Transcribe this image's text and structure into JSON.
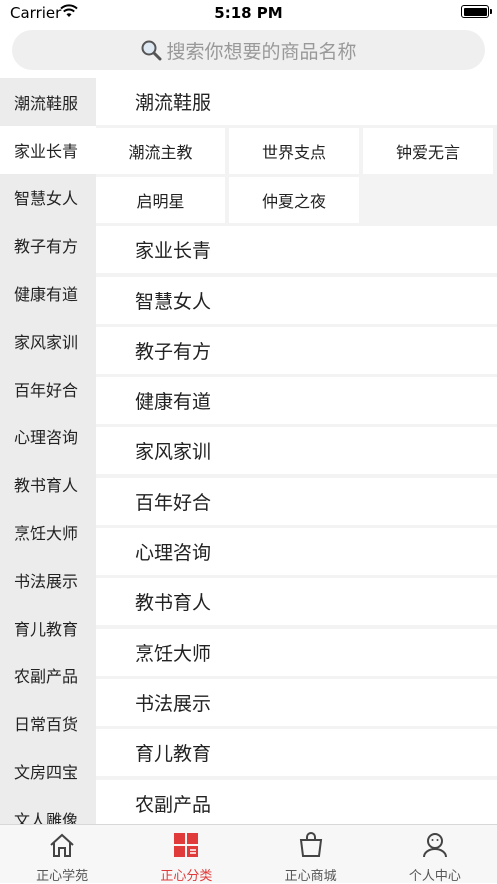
{
  "status_bar": {
    "carrier": "Carrier",
    "time": "5:18 PM"
  },
  "search": {
    "placeholder": "搜索你想要的商品名称"
  },
  "sidebar": {
    "items": [
      "潮流鞋服",
      "家业长青",
      "智慧女人",
      "教子有方",
      "健康有道",
      "家风家训",
      "百年好合",
      "心理咨询",
      "教书育人",
      "烹饪大师",
      "书法展示",
      "育儿教育",
      "农副产品",
      "日常百货",
      "文房四宝",
      "文人雕像"
    ],
    "active_index": 1
  },
  "content": {
    "header": "潮流鞋服",
    "subcategories": [
      "潮流主教",
      "世界支点",
      "钟爱无言",
      "启明星",
      "仲夏之夜"
    ],
    "categories": [
      "家业长青",
      "智慧女人",
      "教子有方",
      "健康有道",
      "家风家训",
      "百年好合",
      "心理咨询",
      "教书育人",
      "烹饪大师",
      "书法展示",
      "育儿教育",
      "农副产品"
    ]
  },
  "tabbar": {
    "tabs": [
      {
        "label": "正心学苑",
        "icon": "home-icon"
      },
      {
        "label": "正心分类",
        "icon": "category-icon"
      },
      {
        "label": "正心商城",
        "icon": "shopping-bag-icon"
      },
      {
        "label": "个人中心",
        "icon": "profile-icon"
      }
    ],
    "active_index": 1,
    "active_color": "#e03a3a"
  }
}
